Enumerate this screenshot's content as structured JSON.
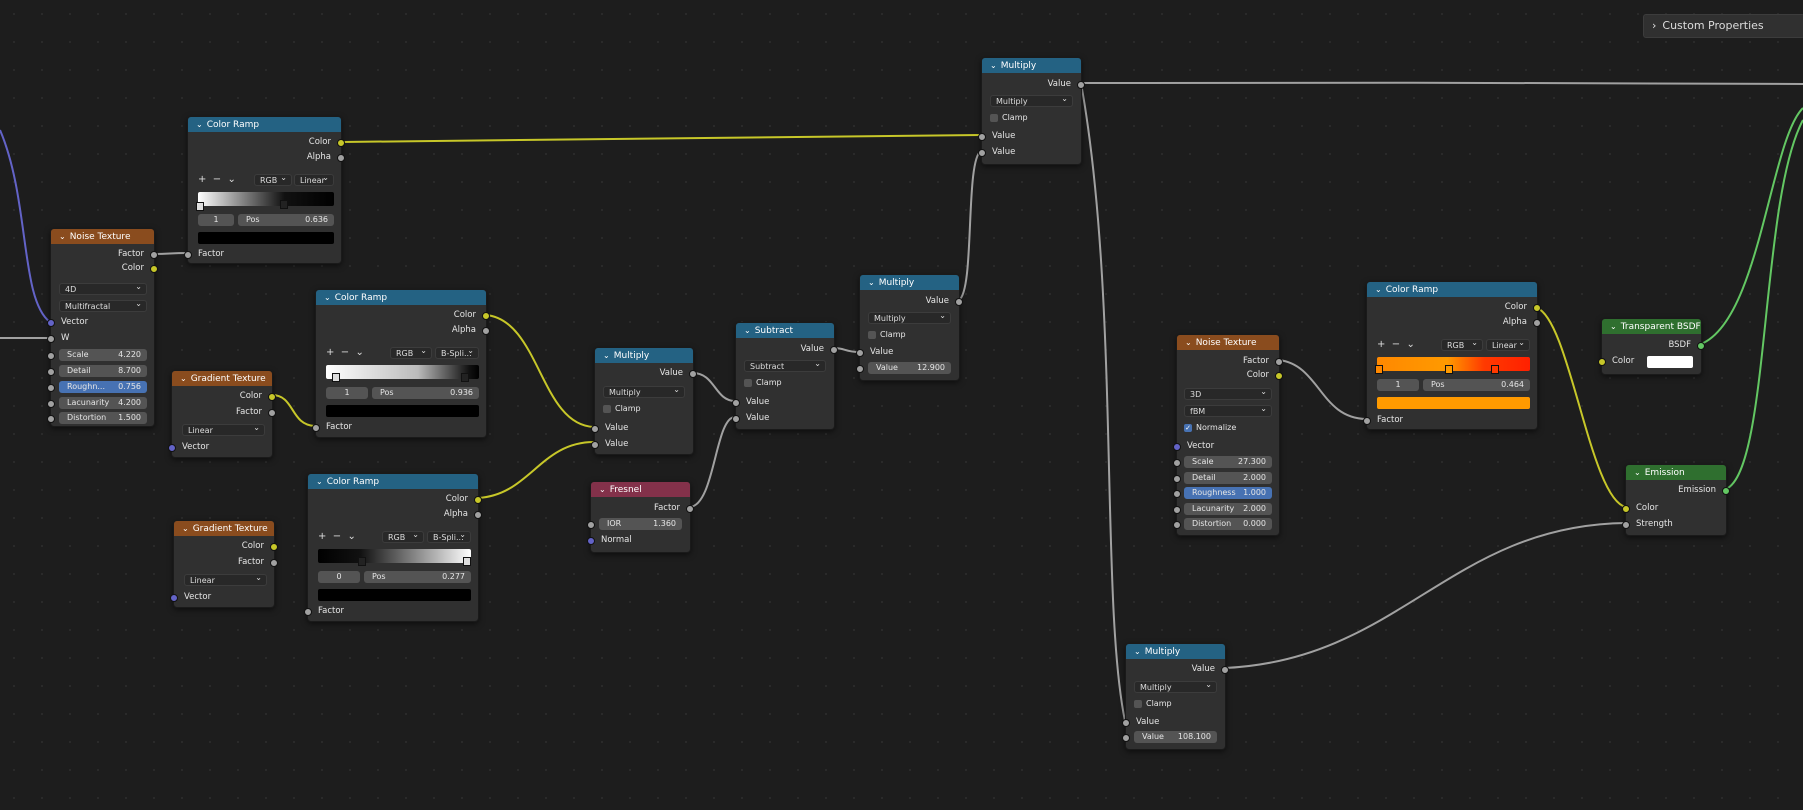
{
  "panel": {
    "custom_properties": "Custom Properties"
  },
  "nodes": {
    "noise1": {
      "title": "Noise Texture",
      "out_factor": "Factor",
      "out_color": "Color",
      "dim": "4D",
      "type": "Multifractal",
      "in_vector": "Vector",
      "in_w": "W",
      "fields": [
        {
          "k": "Scale",
          "v": "4.220"
        },
        {
          "k": "Detail",
          "v": "8.700"
        },
        {
          "k": "Roughn...",
          "v": "0.756"
        },
        {
          "k": "Lacunarity",
          "v": "4.200"
        },
        {
          "k": "Distortion",
          "v": "1.500"
        }
      ]
    },
    "ramp1": {
      "title": "Color Ramp",
      "out_color": "Color",
      "out_alpha": "Alpha",
      "mode": "RGB",
      "interp": "Linear",
      "index": "1",
      "pos_label": "Pos",
      "pos": "0.636",
      "in_factor": "Factor"
    },
    "ramp2": {
      "title": "Color Ramp",
      "out_color": "Color",
      "out_alpha": "Alpha",
      "mode": "RGB",
      "interp": "B-Spli...",
      "index": "1",
      "pos_label": "Pos",
      "pos": "0.936",
      "in_factor": "Factor"
    },
    "ramp3": {
      "title": "Color Ramp",
      "out_color": "Color",
      "out_alpha": "Alpha",
      "mode": "RGB",
      "interp": "B-Spli...",
      "index": "0",
      "pos_label": "Pos",
      "pos": "0.277",
      "in_factor": "Factor"
    },
    "grad1": {
      "title": "Gradient Texture",
      "out_color": "Color",
      "out_factor": "Factor",
      "type": "Linear",
      "in_vector": "Vector"
    },
    "grad2": {
      "title": "Gradient Texture",
      "out_color": "Color",
      "out_factor": "Factor",
      "type": "Linear",
      "in_vector": "Vector"
    },
    "mult1": {
      "title": "Multiply",
      "out_value": "Value",
      "op": "Multiply",
      "clamp": "Clamp",
      "in1": "Value",
      "in2": "Value"
    },
    "fresnel": {
      "title": "Fresnel",
      "out_factor": "Factor",
      "ior_label": "IOR",
      "ior": "1.360",
      "in_normal": "Normal"
    },
    "sub": {
      "title": "Subtract",
      "out_value": "Value",
      "op": "Subtract",
      "clamp": "Clamp",
      "in1": "Value",
      "in2": "Value"
    },
    "mult2": {
      "title": "Multiply",
      "out_value": "Value",
      "op": "Multiply",
      "clamp": "Clamp",
      "in1": "Value",
      "val_label": "Value",
      "val": "12.900"
    },
    "mult3": {
      "title": "Multiply",
      "out_value": "Value",
      "op": "Multiply",
      "clamp": "Clamp",
      "in1": "Value",
      "in2": "Value"
    },
    "noise2": {
      "title": "Noise Texture",
      "out_factor": "Factor",
      "out_color": "Color",
      "dim": "3D",
      "type": "fBM",
      "normalize": "Normalize",
      "in_vector": "Vector",
      "fields": [
        {
          "k": "Scale",
          "v": "27.300"
        },
        {
          "k": "Detail",
          "v": "2.000"
        },
        {
          "k": "Roughness",
          "v": "1.000"
        },
        {
          "k": "Lacunarity",
          "v": "2.000"
        },
        {
          "k": "Distortion",
          "v": "0.000"
        }
      ]
    },
    "ramp4": {
      "title": "Color Ramp",
      "out_color": "Color",
      "out_alpha": "Alpha",
      "mode": "RGB",
      "interp": "Linear",
      "index": "1",
      "pos_label": "Pos",
      "pos": "0.464",
      "in_factor": "Factor"
    },
    "mult4": {
      "title": "Multiply",
      "out_value": "Value",
      "op": "Multiply",
      "clamp": "Clamp",
      "in1": "Value",
      "val_label": "Value",
      "val": "108.100"
    },
    "transparent": {
      "title": "Transparent BSDF",
      "out_bsdf": "BSDF",
      "in_color": "Color"
    },
    "emission": {
      "title": "Emission",
      "out_emission": "Emission",
      "in_color": "Color",
      "in_strength": "Strength"
    }
  },
  "colors": {
    "converter_header": "#246283",
    "texture_header": "#8a4c1e",
    "input_header": "#83314a",
    "shader_header": "#2f6f2f",
    "socket_color": "#c7c729",
    "socket_float": "#a1a1a1",
    "socket_vector": "#6363c7",
    "socket_shader": "#63c763",
    "orange_ramp": "#ff9a00"
  }
}
